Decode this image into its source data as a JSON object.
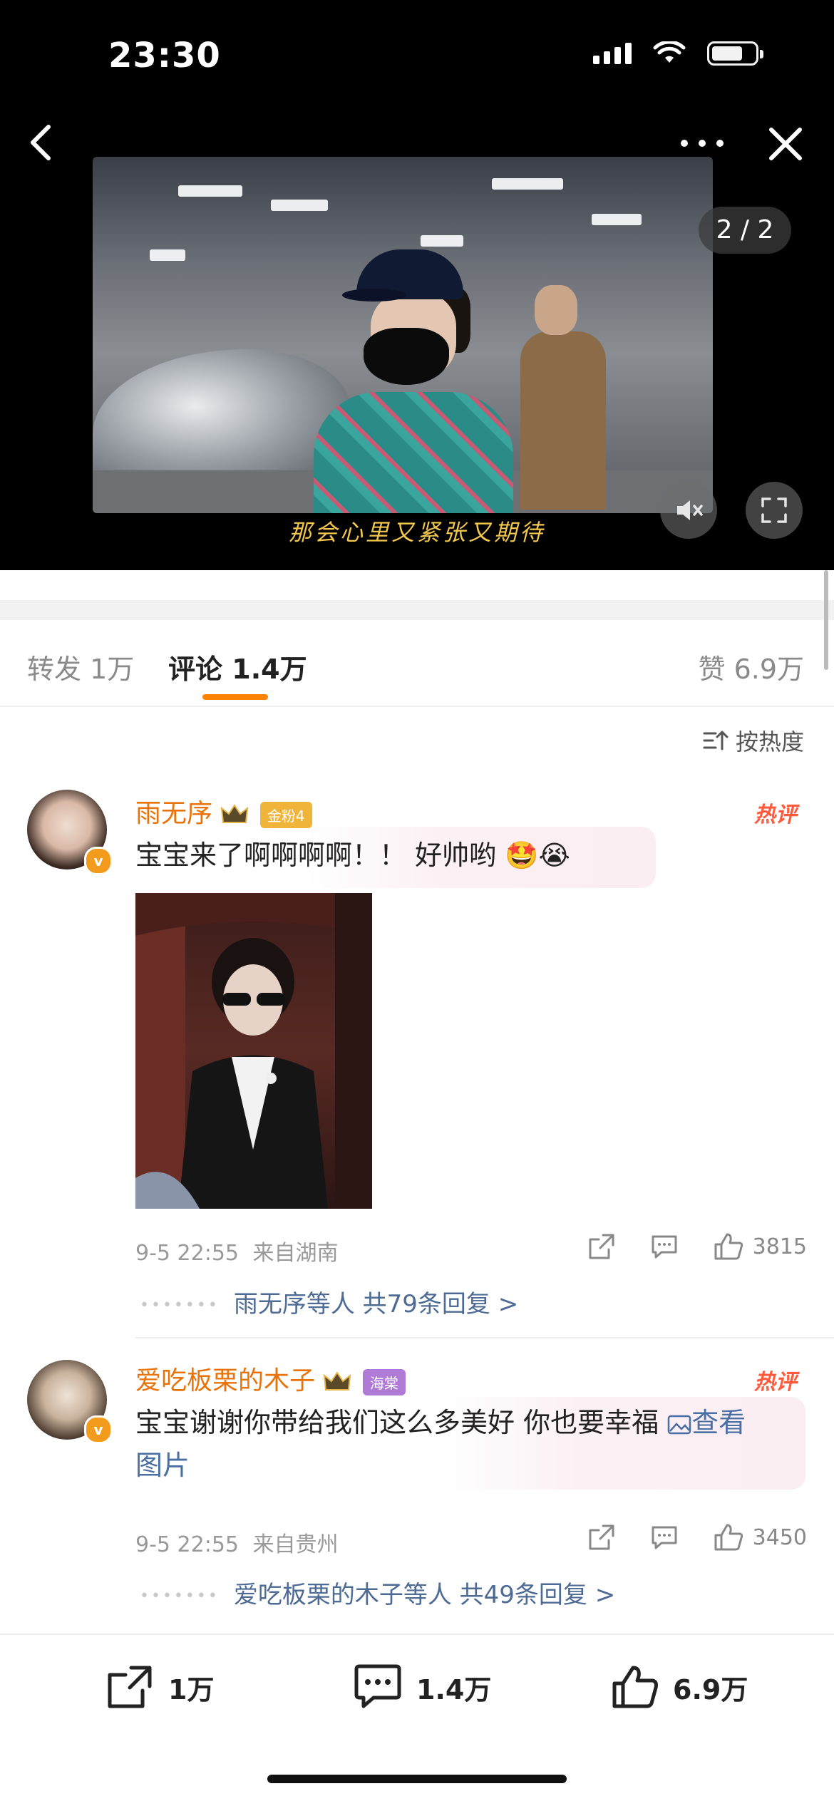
{
  "status_bar": {
    "time": "23:30"
  },
  "viewer": {
    "page_indicator": "2 / 2",
    "subtitle": "那会心里又紧张又期待"
  },
  "tabs": {
    "repost": {
      "label": "转发",
      "count": "1万"
    },
    "comments": {
      "label": "评论",
      "count": "1.4万"
    },
    "likes": {
      "label": "赞",
      "count": "6.9万"
    }
  },
  "sort": {
    "label": "按热度"
  },
  "comments": [
    {
      "username": "雨无序",
      "fan_badge": "金粉4",
      "hot_tag": "热评",
      "text": "宝宝来了啊啊啊啊！！ 好帅哟",
      "emoji": [
        "🤩",
        "😭"
      ],
      "time": "9-5 22:55",
      "location": "来自湖南",
      "likes": "3815",
      "replies": "雨无序等人 共79条回复 >",
      "vbadge": "v"
    },
    {
      "username": "爱吃板栗的木子",
      "fan_badge": "海棠",
      "hot_tag": "热评",
      "text": "宝宝谢谢你带给我们这么多美好 你也要幸福",
      "link_text": "查看",
      "link_text_2": "图片",
      "time": "9-5 22:55",
      "location": "来自贵州",
      "likes": "3450",
      "replies": "爱吃板栗的木子等人 共49条回复 >",
      "vbadge": "v"
    }
  ],
  "bottom_bar": {
    "share_count": "1万",
    "comment_count": "1.4万",
    "like_count": "6.9万"
  },
  "colors": {
    "accent": "#ff8200",
    "username": "#e8730a",
    "link": "#4d6b94",
    "hot": "#ff5a3c"
  }
}
